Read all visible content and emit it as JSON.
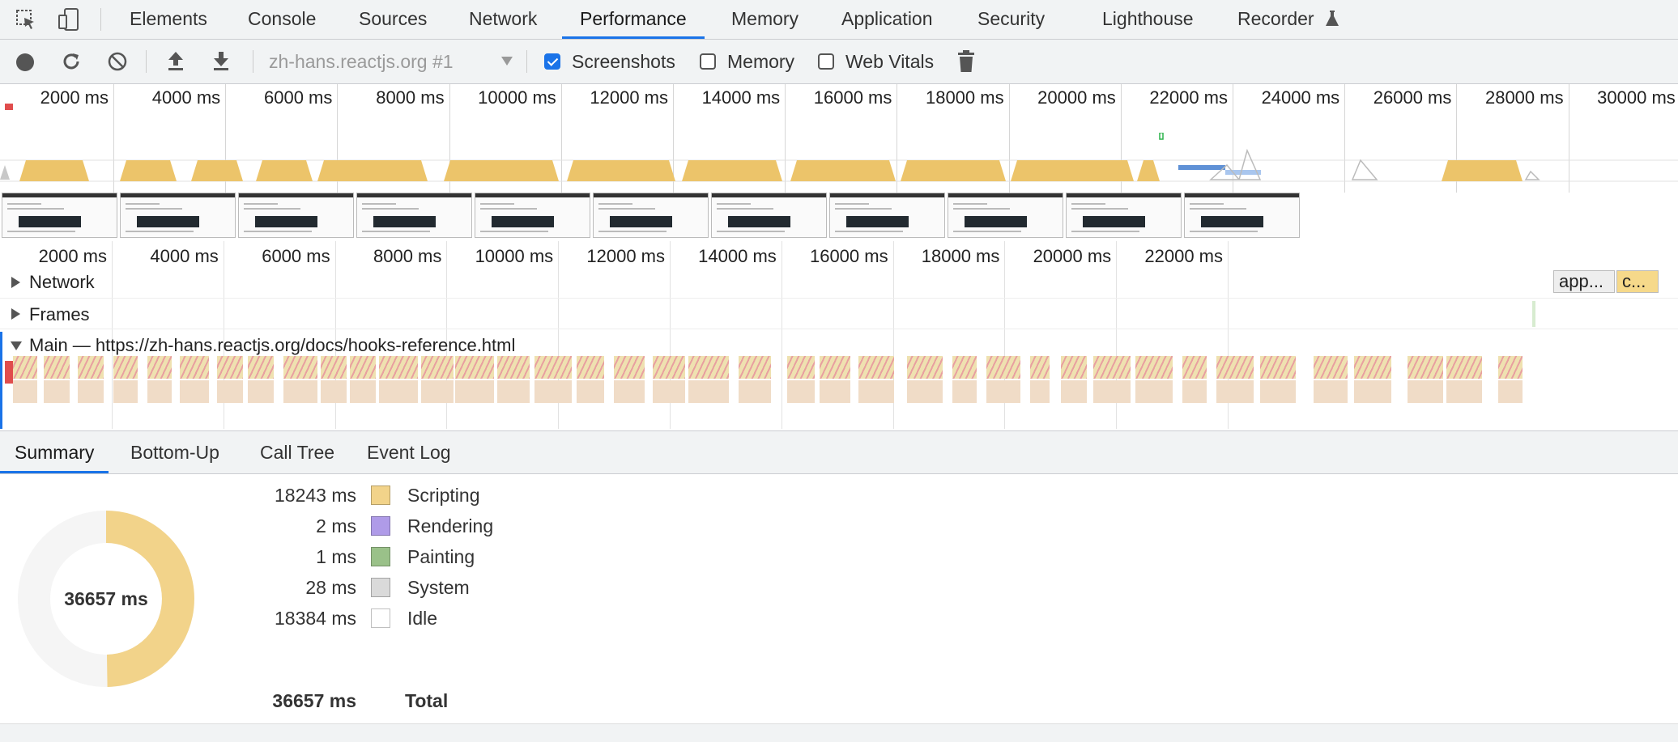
{
  "tabs": [
    {
      "label": "Elements"
    },
    {
      "label": "Console"
    },
    {
      "label": "Sources"
    },
    {
      "label": "Network"
    },
    {
      "label": "Performance"
    },
    {
      "label": "Memory"
    },
    {
      "label": "Application"
    },
    {
      "label": "Security"
    },
    {
      "label": "Lighthouse"
    },
    {
      "label": "Recorder"
    }
  ],
  "toolbar": {
    "profile_select": "zh-hans.reactjs.org #1",
    "screenshots_label": "Screenshots",
    "screenshots_checked": true,
    "memory_label": "Memory",
    "memory_checked": false,
    "webvitals_label": "Web Vitals",
    "webvitals_checked": false
  },
  "overview": {
    "ticks": [
      "2000 ms",
      "4000 ms",
      "6000 ms",
      "8000 ms",
      "10000 ms",
      "12000 ms",
      "14000 ms",
      "16000 ms",
      "18000 ms",
      "20000 ms",
      "22000 ms",
      "24000 ms",
      "26000 ms",
      "28000 ms",
      "30000 ms"
    ]
  },
  "timeline": {
    "ticks": [
      "2000 ms",
      "4000 ms",
      "6000 ms",
      "8000 ms",
      "10000 ms",
      "12000 ms",
      "14000 ms",
      "16000 ms",
      "18000 ms",
      "20000 ms",
      "22000 ms"
    ],
    "network_label": "Network",
    "frames_label": "Frames",
    "main_label": "Main — https://zh-hans.reactjs.org/docs/hooks-reference.html",
    "network_item_1": "app...",
    "network_item_2": "c..."
  },
  "details_tabs": [
    {
      "label": "Summary"
    },
    {
      "label": "Bottom-Up"
    },
    {
      "label": "Call Tree"
    },
    {
      "label": "Event Log"
    }
  ],
  "summary": {
    "total_center": "36657 ms",
    "rows": [
      {
        "value": "18243 ms",
        "label": "Scripting",
        "color": "#f2d38a"
      },
      {
        "value": "2 ms",
        "label": "Rendering",
        "color": "#af9be8"
      },
      {
        "value": "1 ms",
        "label": "Painting",
        "color": "#9ac189"
      },
      {
        "value": "28 ms",
        "label": "System",
        "color": "#dadada"
      },
      {
        "value": "18384 ms",
        "label": "Idle",
        "color": "#ffffff"
      }
    ],
    "total_value": "36657 ms",
    "total_label": "Total",
    "scripting_fraction": 0.4977
  },
  "colors": {
    "accent": "#1a73e8",
    "scripting": "#f2d38a",
    "idle_ring": "#f5f5f5"
  }
}
